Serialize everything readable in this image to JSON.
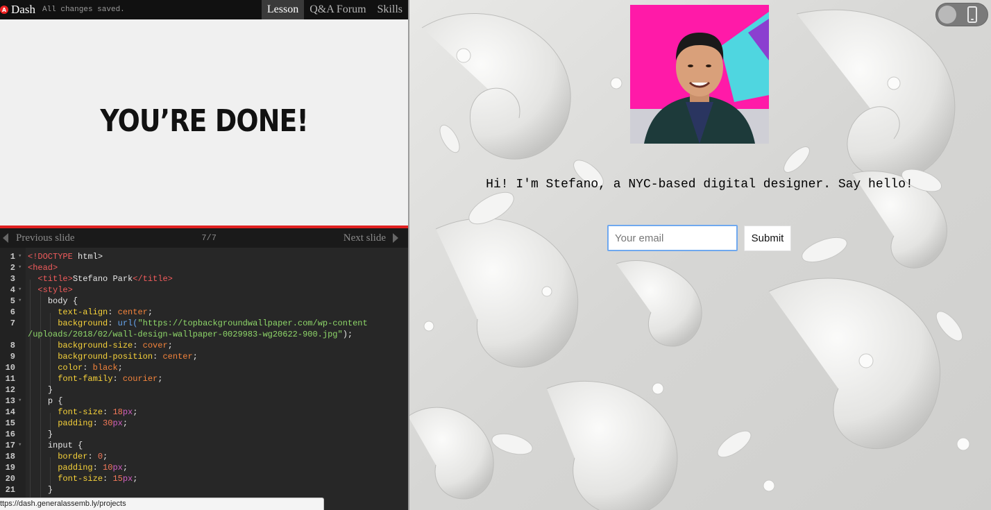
{
  "app": {
    "logo_letter": "A",
    "title": "Dash",
    "save_status": "All changes saved."
  },
  "tabs": [
    {
      "label": "Lesson",
      "active": true
    },
    {
      "label": "Q&A Forum",
      "active": false
    },
    {
      "label": "Skills",
      "active": false
    }
  ],
  "lesson": {
    "heading": "YOU’RE DONE!"
  },
  "slide_nav": {
    "prev_label": "Previous slide",
    "next_label": "Next slide",
    "counter": "7/7"
  },
  "code_lines": [
    {
      "num": "1",
      "fold": true
    },
    {
      "num": "2",
      "fold": true
    },
    {
      "num": "3",
      "fold": false
    },
    {
      "num": "4",
      "fold": true
    },
    {
      "num": "5",
      "fold": true
    },
    {
      "num": "6",
      "fold": false
    },
    {
      "num": "7",
      "fold": false
    },
    {
      "num": "",
      "fold": false
    },
    {
      "num": "8",
      "fold": false
    },
    {
      "num": "9",
      "fold": false
    },
    {
      "num": "10",
      "fold": false
    },
    {
      "num": "11",
      "fold": false
    },
    {
      "num": "12",
      "fold": false
    },
    {
      "num": "13",
      "fold": true
    },
    {
      "num": "14",
      "fold": false
    },
    {
      "num": "15",
      "fold": false
    },
    {
      "num": "16",
      "fold": false
    },
    {
      "num": "17",
      "fold": true
    },
    {
      "num": "18",
      "fold": false
    },
    {
      "num": "19",
      "fold": false
    },
    {
      "num": "20",
      "fold": false
    },
    {
      "num": "21",
      "fold": false
    }
  ],
  "code": {
    "doctype_bang": "<!",
    "doctype_kw": "DOCTYPE",
    "doctype_rest": " html>",
    "head_open": "<head>",
    "title_open": "<title>",
    "title_text": "Stefano Park",
    "title_close": "</title>",
    "style_open": "<style>",
    "body_selector": "body {",
    "p_selector": "p {",
    "input_selector": "input {",
    "close_brace": "}",
    "bg_url_fn": "url(",
    "bg_url_1": "\"https://topbackgroundwallpaper.com/wp-content",
    "bg_url_2": "/uploads/2018/02/wall-design-wallpaper-0029983-wg20622-900.jpg\"",
    "bg_url_close": ");",
    "props": {
      "text_align": "text-align",
      "background": "background",
      "background_size": "background-size",
      "background_position": "background-position",
      "color": "color",
      "font_family": "font-family",
      "font_size": "font-size",
      "padding": "padding",
      "border": "border"
    },
    "vals": {
      "center": "center",
      "cover": "cover",
      "black": "black",
      "courier": "courier",
      "n18": "18",
      "n30": "30",
      "n0": "0",
      "n10": "10",
      "n15": "15",
      "px": "px"
    }
  },
  "status_url": "ttps://dash.generalassemb.ly/projects",
  "preview": {
    "tagline": "Hi! I'm Stefano, a NYC-based digital designer. Say hello!",
    "email_placeholder": "Your email",
    "submit_label": "Submit"
  },
  "icons": {
    "logo": "general-assembly-logo",
    "prev": "triangle-left-icon",
    "next": "triangle-right-icon",
    "device": "phone-icon",
    "fold": "fold-arrow-icon"
  },
  "colors": {
    "accent_red": "#e02020",
    "input_focus": "#6fa8ef",
    "avatar_bg": "#ff1aa8"
  }
}
